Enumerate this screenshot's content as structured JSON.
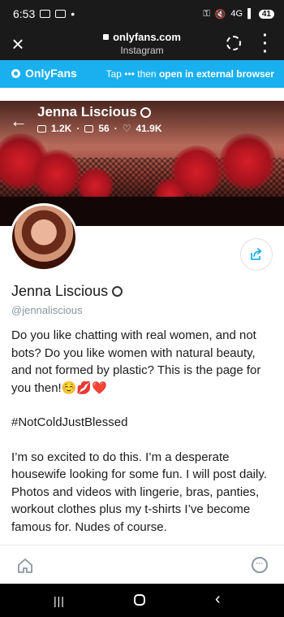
{
  "status_bar": {
    "time": "6:53",
    "battery": "41",
    "signal_label": "4G"
  },
  "browser": {
    "domain": "onlyfans.com",
    "subtitle": "Instagram"
  },
  "banner": {
    "logo_text": "OnlyFans",
    "tip_prefix": "Tap",
    "tip_dots": "•••",
    "tip_mid": "then",
    "tip_action": "open in external browser"
  },
  "cover": {
    "name": "Jenna Liscious",
    "stats": {
      "photos": "1.2K",
      "videos": "56",
      "likes": "41.9K"
    }
  },
  "profile": {
    "name": "Jenna Liscious",
    "handle": "@jennaliscious",
    "bio": [
      "Do you like chatting with real women, and not bots? Do you like women with natural beauty, and not formed by plastic? This is the page for you then!☺️💋❤️",
      "#NotColdJustBlessed",
      "I’m so excited to do this. I’m a desperate housewife looking for some fun. I will post daily. Photos and videos with lingerie, bras, panties, workout clothes plus my t-shirts I’ve become famous for. Nudes of course."
    ]
  },
  "icons": {
    "close": "close-icon",
    "lock": "lock-icon",
    "timer": "timer-icon",
    "menu": "more-vert-icon",
    "back": "arrow-back-icon",
    "photo": "image-icon",
    "video": "video-icon",
    "heart": "heart-icon",
    "share": "share-icon",
    "home": "home-icon",
    "more": "more-icon"
  },
  "colors": {
    "brand": "#1ab0ef",
    "muted": "#8a96a3"
  }
}
